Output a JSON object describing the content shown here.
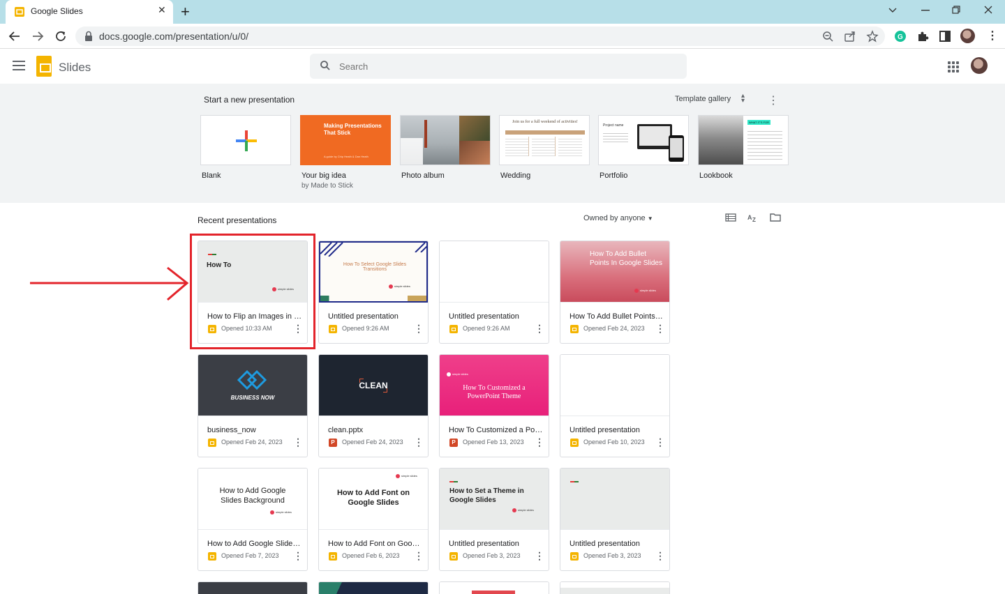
{
  "browser": {
    "tab_title": "Google Slides",
    "url": "docs.google.com/presentation/u/0/"
  },
  "app": {
    "name": "Slides",
    "search_placeholder": "Search"
  },
  "templates": {
    "heading": "Start a new presentation",
    "gallery_label": "Template gallery",
    "items": [
      {
        "label": "Blank",
        "sub": ""
      },
      {
        "label": "Your big idea",
        "sub": "by Made to Stick",
        "thumb_title": "Making Presentations That Stick",
        "thumb_sub": "A guide by Chip Heath & Dan Heath"
      },
      {
        "label": "Photo album",
        "sub": ""
      },
      {
        "label": "Wedding",
        "sub": "",
        "thumb_title": "Join us for a full weekend of activities!"
      },
      {
        "label": "Portfolio",
        "sub": "",
        "thumb_title": "Project name"
      },
      {
        "label": "Lookbook",
        "sub": "",
        "thumb_title": "WHAT IT'S FOR"
      }
    ]
  },
  "recent": {
    "heading": "Recent presentations",
    "owner_filter": "Owned by anyone",
    "cards": [
      {
        "name": "How to Flip an Images in Google Slides",
        "opened": "Opened 10:33 AM",
        "type": "slides",
        "thumb_text": "How To",
        "brand": "simple slides"
      },
      {
        "name": "Untitled presentation",
        "opened": "Opened 9:26 AM",
        "type": "slides",
        "thumb_text": "How To Select Google Slides Transitions",
        "brand": "simple slides"
      },
      {
        "name": "Untitled presentation",
        "opened": "Opened 9:26 AM",
        "type": "slides",
        "thumb_text": ""
      },
      {
        "name": "How To Add Bullet Points In Google Slides",
        "opened": "Opened Feb 24, 2023",
        "type": "slides",
        "thumb_text": "How To Add Bullet Points In Google Slides",
        "brand": "simple slides"
      },
      {
        "name": "business_now",
        "opened": "Opened Feb 24, 2023",
        "type": "slides",
        "thumb_text": "BUSINESS NOW"
      },
      {
        "name": "clean.pptx",
        "opened": "Opened Feb 24, 2023",
        "type": "ppt",
        "thumb_text": "CLEAN"
      },
      {
        "name": "How To Customized a PowerPoint Theme",
        "opened": "Opened Feb 13, 2023",
        "type": "ppt",
        "thumb_text": "How To Customized a PowerPoint Theme",
        "brand": "simple slides"
      },
      {
        "name": "Untitled presentation",
        "opened": "Opened Feb 10, 2023",
        "type": "slides",
        "thumb_text": ""
      },
      {
        "name": "How to Add Google Slides Background",
        "opened": "Opened Feb 7, 2023",
        "type": "slides",
        "thumb_text": "How to Add Google Slides Background",
        "brand": "simple slides"
      },
      {
        "name": "How to Add Font on Google Slides",
        "opened": "Opened Feb 6, 2023",
        "type": "slides",
        "thumb_text": "How to Add Font on Google Slides",
        "brand": "simple slides"
      },
      {
        "name": "Untitled presentation",
        "opened": "Opened Feb 3, 2023",
        "type": "slides",
        "thumb_text": "How to Set a Theme in Google Slides",
        "brand": "simple slides"
      },
      {
        "name": "Untitled presentation",
        "opened": "Opened Feb 3, 2023",
        "type": "slides",
        "thumb_text": ""
      }
    ]
  },
  "colors": {
    "tabstrip": "#b7dfe8",
    "slides_yellow": "#f4b400",
    "highlight_red": "#e3242b",
    "template_bg": "#f1f3f4"
  }
}
